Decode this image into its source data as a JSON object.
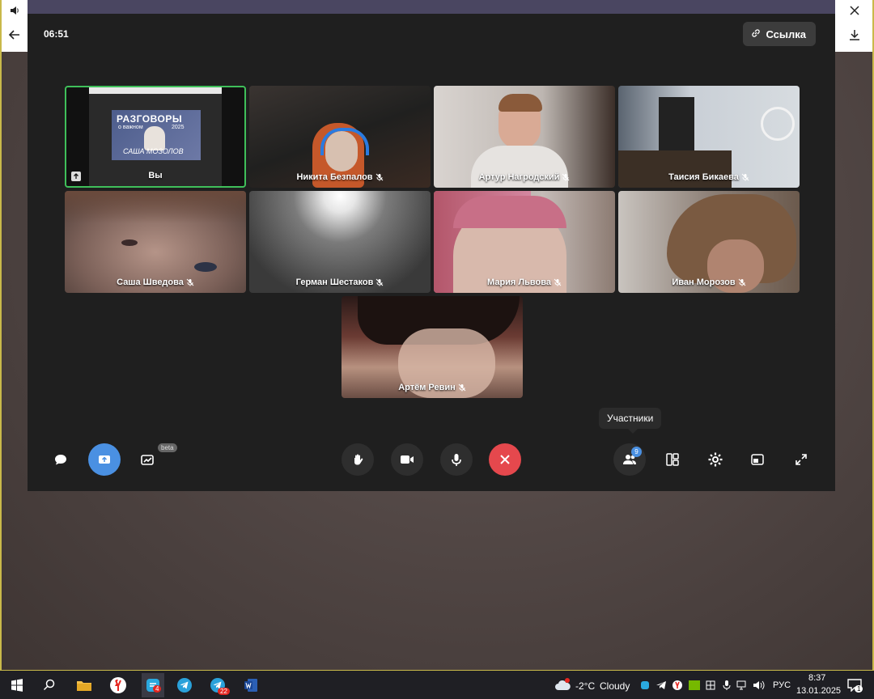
{
  "browser": {
    "volume_icon": "speaker-icon",
    "back_icon": "arrow-left-icon",
    "close_icon": "close-icon",
    "download_icon": "download-icon"
  },
  "call": {
    "timer": "06:51",
    "link_label": "Ссылка",
    "tooltip": "Участники",
    "participants_count": "9",
    "beta_label": "beta",
    "tiles": [
      {
        "name": "Вы",
        "muted": false
      },
      {
        "name": "Никита Безпалов",
        "muted": true
      },
      {
        "name": "Артур Нагродский",
        "muted": true
      },
      {
        "name": "Таисия Бикаева",
        "muted": true
      },
      {
        "name": "Саша Шведова",
        "muted": true
      },
      {
        "name": "Герман Шестаков",
        "muted": true
      },
      {
        "name": "Мария Львова",
        "muted": true
      },
      {
        "name": "Иван Морозов",
        "muted": true
      },
      {
        "name": "Артём Ревин",
        "muted": true
      }
    ],
    "screen_share": {
      "title": "РАЗГОВОРЫ",
      "subtitle": "о важном",
      "year": "2025",
      "signature": "САША МОЗОЛОВ"
    },
    "colors": {
      "accent": "#4a90e2",
      "end_call": "#e5484d",
      "active_speaker": "#3fbf5a",
      "panel": "#1f1f1f"
    }
  },
  "taskbar": {
    "weather_temp": "-2°C",
    "weather_text": "Cloudy",
    "language": "РУС",
    "time": "8:37",
    "date": "13.01.2025",
    "yandex_badge": "4",
    "telegram_badge": "22",
    "notification_badge": "1"
  }
}
